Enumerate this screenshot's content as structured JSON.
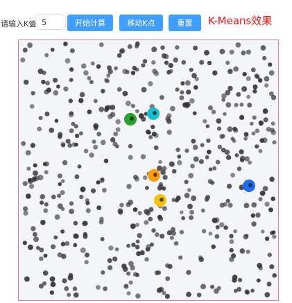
{
  "toolbar": {
    "k_label": "请输入K值:",
    "k_value": "5",
    "start_button": "开始计算",
    "move_button": "移动K点",
    "reset_button": "重置",
    "title": "K-Means效果"
  },
  "canvas": {
    "point_count": 520,
    "point_color": "#333333",
    "background": "#f4f5f9",
    "border_color": "#e07a86",
    "centroid_colors": [
      "#2ca02c",
      "#17becf",
      "#ff9f0f",
      "#f2c40f",
      "#1e6cf0"
    ]
  }
}
